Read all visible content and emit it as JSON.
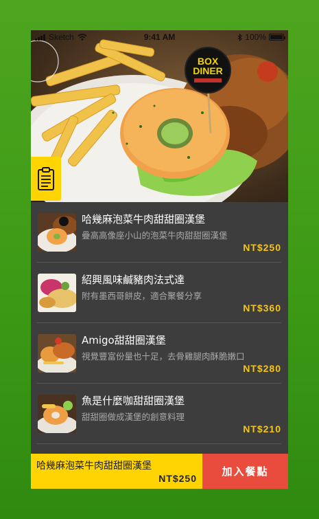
{
  "status_bar": {
    "carrier": "Sketch",
    "time": "9:41 AM",
    "battery": "100%",
    "battery_level": 1.0
  },
  "hero": {
    "logo_line1": "BOX",
    "logo_line2": "DINER"
  },
  "menu": {
    "items": [
      {
        "title": "哈幾麻泡菜牛肉甜甜圈漢堡",
        "desc": "疊高高像座小山的泡菜牛肉甜甜圈漢堡",
        "price": "NT$250"
      },
      {
        "title": "紹興風味鹹豬肉法式達",
        "desc": "附有墨西哥餅皮，適合聚餐分享",
        "price": "NT$360"
      },
      {
        "title": "Amigo甜甜圈漢堡",
        "desc": "視覺豐富份量也十足，去骨雞腿肉酥脆嫩口",
        "price": "NT$280"
      },
      {
        "title": "魚是什麼咖甜甜圈漢堡",
        "desc": "甜甜圈做成漢堡的創意料理",
        "price": "NT$210"
      }
    ]
  },
  "cart": {
    "selected_name": "哈幾麻泡菜牛肉甜甜圈漢堡",
    "selected_price": "NT$250",
    "add_label": "加入餐點"
  },
  "colors": {
    "accent_yellow": "#ffd400",
    "price_yellow": "#f3c51a",
    "add_button_red": "#e94b3c",
    "list_background": "#3d3d3d",
    "page_background": "#4ea51f"
  },
  "icons": [
    "signal-icon",
    "wifi-icon",
    "bluetooth-icon",
    "battery-icon",
    "clipboard-icon"
  ]
}
